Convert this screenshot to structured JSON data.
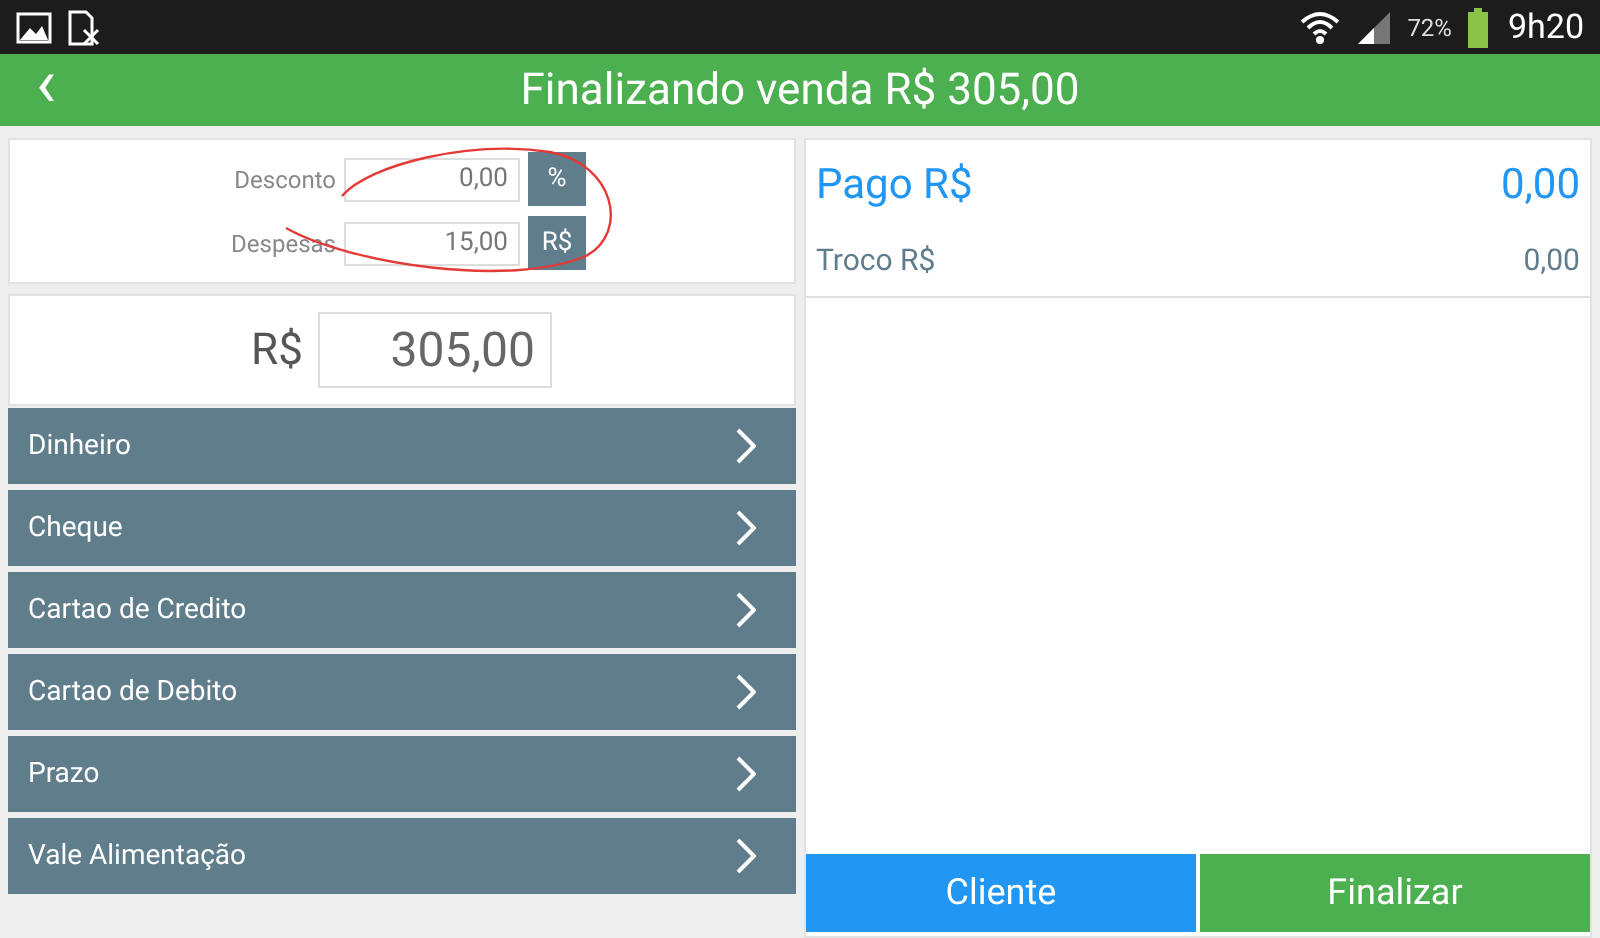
{
  "status_bar": {
    "battery_percent": "72%",
    "time": "9h20"
  },
  "app_bar": {
    "back": "‹",
    "title": "Finalizando venda R$ 305,00"
  },
  "adjustments": [
    {
      "label": "Desconto",
      "value": "0,00",
      "unit": "%"
    },
    {
      "label": "Despesas",
      "value": "15,00",
      "unit": "R$"
    }
  ],
  "amount": {
    "currency": "R$",
    "value": "305,00"
  },
  "payment_methods": [
    {
      "label": "Dinheiro"
    },
    {
      "label": "Cheque"
    },
    {
      "label": "Cartao de Credito"
    },
    {
      "label": "Cartao de Debito"
    },
    {
      "label": "Prazo"
    },
    {
      "label": "Vale Alimentação"
    }
  ],
  "summary": {
    "paid_label": "Pago R$",
    "paid_value": "0,00",
    "change_label": "Troco R$",
    "change_value": "0,00"
  },
  "buttons": [
    {
      "label": "Cliente",
      "kind": "secondary"
    },
    {
      "label": "Finalizar",
      "kind": "primary"
    }
  ]
}
